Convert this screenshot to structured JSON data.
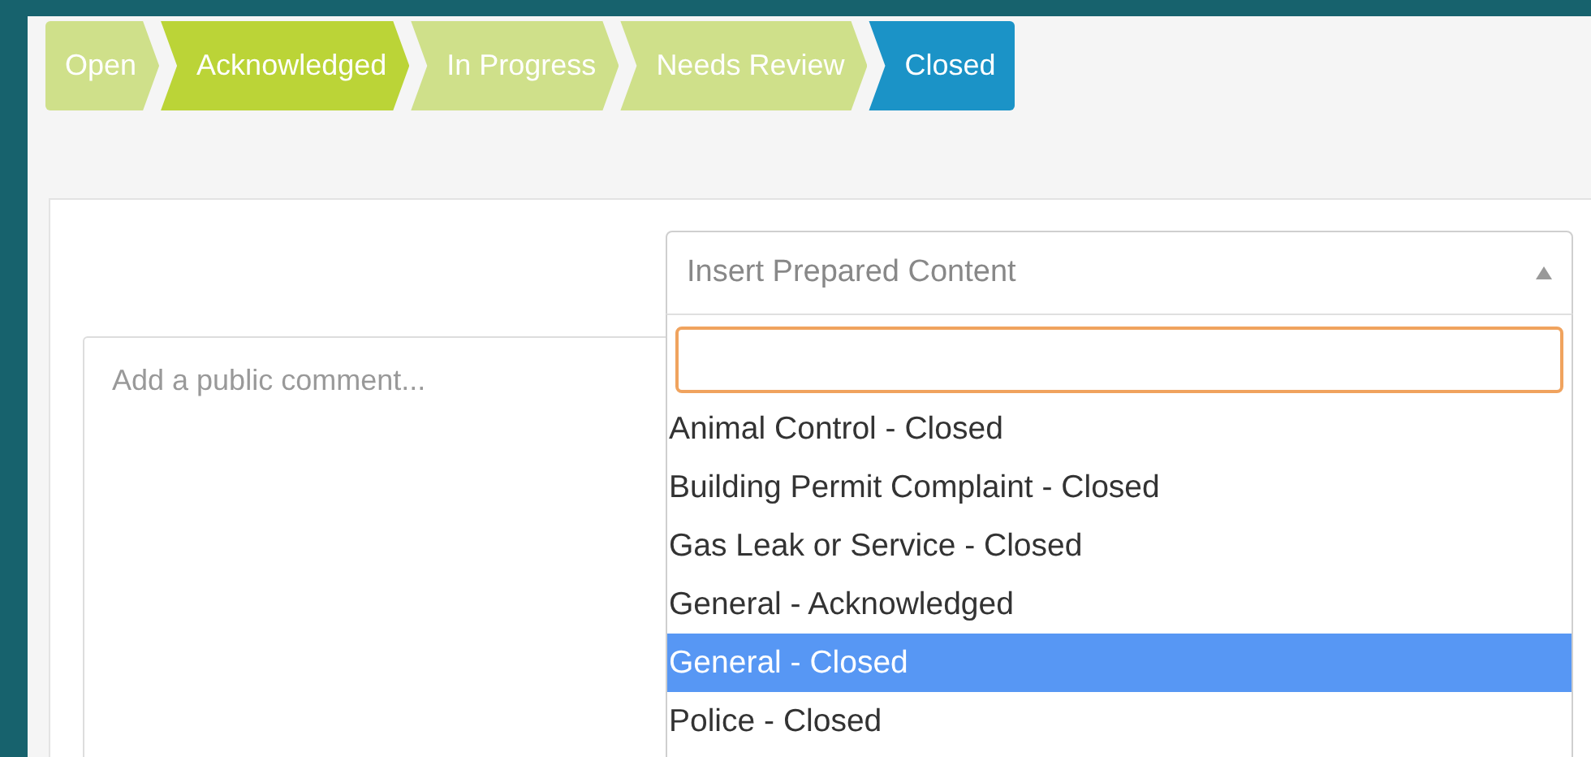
{
  "stepper": [
    {
      "label": "Open",
      "color": "#cfe08a",
      "selected": false
    },
    {
      "label": "Acknowledged",
      "color": "#bbd437",
      "selected": false
    },
    {
      "label": "In Progress",
      "color": "#cfe08a",
      "selected": false
    },
    {
      "label": "Needs Review",
      "color": "#cfe08a",
      "selected": false
    },
    {
      "label": "Closed",
      "color": "#1b93c7",
      "selected": true
    }
  ],
  "comment": {
    "placeholder": "Add a public comment..."
  },
  "prepared_content": {
    "placeholder": "Insert Prepared Content",
    "expanded": true,
    "options": [
      {
        "label": "Animal Control - Closed",
        "selected": false
      },
      {
        "label": "Building Permit Complaint - Closed",
        "selected": false
      },
      {
        "label": "Gas Leak or Service - Closed",
        "selected": false
      },
      {
        "label": "General - Acknowledged",
        "selected": false
      },
      {
        "label": "General - Closed",
        "selected": true
      },
      {
        "label": "Police - Closed",
        "selected": false
      }
    ]
  }
}
